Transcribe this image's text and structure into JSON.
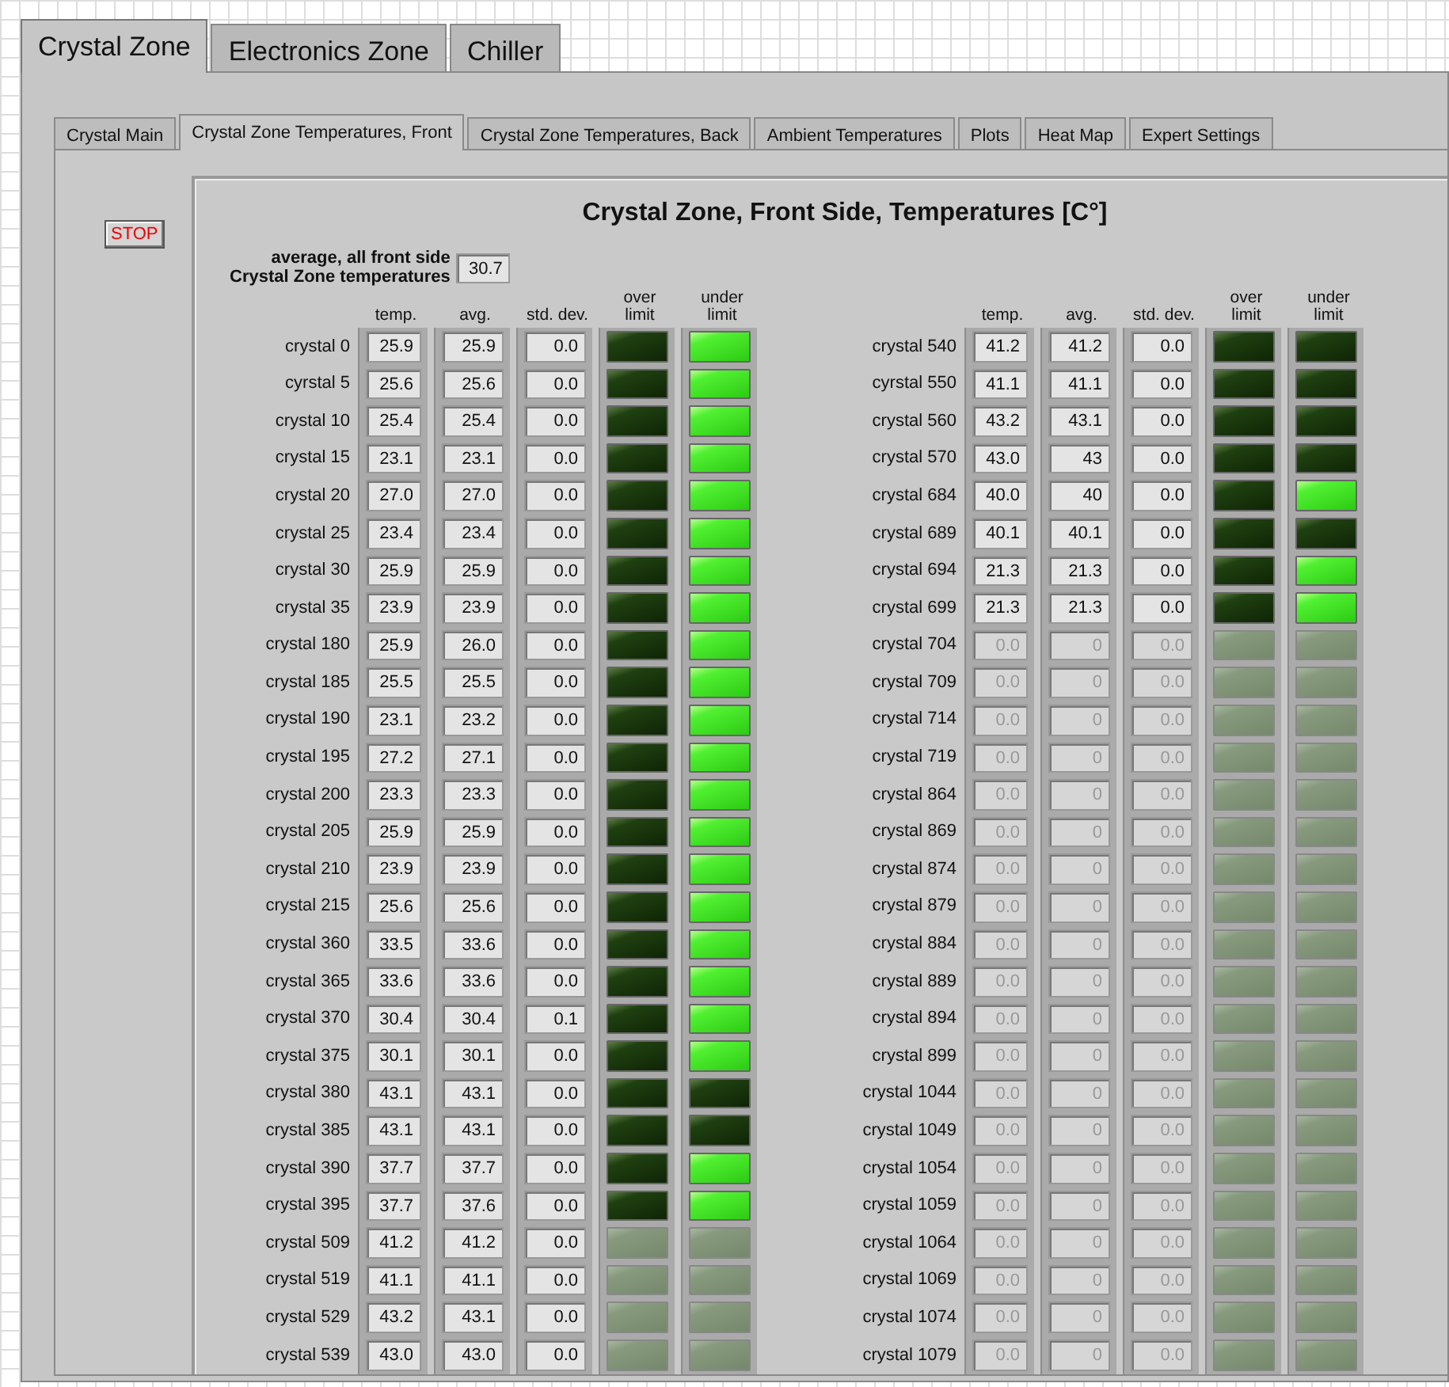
{
  "top_tabs": [
    {
      "label": "Crystal Zone",
      "selected": true
    },
    {
      "label": "Electronics Zone",
      "selected": false
    },
    {
      "label": "Chiller",
      "selected": false
    }
  ],
  "sub_tabs": [
    {
      "label": "Crystal Main",
      "selected": false
    },
    {
      "label": "Crystal Zone Temperatures, Front",
      "selected": true
    },
    {
      "label": "Crystal Zone Temperatures, Back",
      "selected": false
    },
    {
      "label": "Ambient Temperatures",
      "selected": false
    },
    {
      "label": "Plots",
      "selected": false
    },
    {
      "label": "Heat Map",
      "selected": false
    },
    {
      "label": "Expert Settings",
      "selected": false
    }
  ],
  "stop_button": "STOP",
  "title": "Crystal Zone, Front Side, Temperatures [C°]",
  "average": {
    "label_lines": [
      "average, all front side",
      "Crystal Zone temperatures"
    ],
    "value": "30.7"
  },
  "groups": [
    {
      "columns": [
        "temp.",
        "avg.",
        "std. dev.",
        "over limit",
        "under limit"
      ],
      "rows": [
        {
          "label": "crystal 0",
          "temp": "25.9",
          "avg": "25.9",
          "std": "0.0",
          "values_disabled": false,
          "leds_disabled": false,
          "over_limit": false,
          "under_limit": true
        },
        {
          "label": "cyrstal 5",
          "temp": "25.6",
          "avg": "25.6",
          "std": "0.0",
          "values_disabled": false,
          "leds_disabled": false,
          "over_limit": false,
          "under_limit": true
        },
        {
          "label": "crystal 10",
          "temp": "25.4",
          "avg": "25.4",
          "std": "0.0",
          "values_disabled": false,
          "leds_disabled": false,
          "over_limit": false,
          "under_limit": true
        },
        {
          "label": "crystal 15",
          "temp": "23.1",
          "avg": "23.1",
          "std": "0.0",
          "values_disabled": false,
          "leds_disabled": false,
          "over_limit": false,
          "under_limit": true
        },
        {
          "label": "crystal 20",
          "temp": "27.0",
          "avg": "27.0",
          "std": "0.0",
          "values_disabled": false,
          "leds_disabled": false,
          "over_limit": false,
          "under_limit": true
        },
        {
          "label": "crystal 25",
          "temp": "23.4",
          "avg": "23.4",
          "std": "0.0",
          "values_disabled": false,
          "leds_disabled": false,
          "over_limit": false,
          "under_limit": true
        },
        {
          "label": "crystal 30",
          "temp": "25.9",
          "avg": "25.9",
          "std": "0.0",
          "values_disabled": false,
          "leds_disabled": false,
          "over_limit": false,
          "under_limit": true
        },
        {
          "label": "crystal 35",
          "temp": "23.9",
          "avg": "23.9",
          "std": "0.0",
          "values_disabled": false,
          "leds_disabled": false,
          "over_limit": false,
          "under_limit": true
        },
        {
          "label": "crystal 180",
          "temp": "25.9",
          "avg": "26.0",
          "std": "0.0",
          "values_disabled": false,
          "leds_disabled": false,
          "over_limit": false,
          "under_limit": true
        },
        {
          "label": "crystal 185",
          "temp": "25.5",
          "avg": "25.5",
          "std": "0.0",
          "values_disabled": false,
          "leds_disabled": false,
          "over_limit": false,
          "under_limit": true
        },
        {
          "label": "crystal 190",
          "temp": "23.1",
          "avg": "23.2",
          "std": "0.0",
          "values_disabled": false,
          "leds_disabled": false,
          "over_limit": false,
          "under_limit": true
        },
        {
          "label": "crystal 195",
          "temp": "27.2",
          "avg": "27.1",
          "std": "0.0",
          "values_disabled": false,
          "leds_disabled": false,
          "over_limit": false,
          "under_limit": true
        },
        {
          "label": "crystal 200",
          "temp": "23.3",
          "avg": "23.3",
          "std": "0.0",
          "values_disabled": false,
          "leds_disabled": false,
          "over_limit": false,
          "under_limit": true
        },
        {
          "label": "crystal 205",
          "temp": "25.9",
          "avg": "25.9",
          "std": "0.0",
          "values_disabled": false,
          "leds_disabled": false,
          "over_limit": false,
          "under_limit": true
        },
        {
          "label": "crystal 210",
          "temp": "23.9",
          "avg": "23.9",
          "std": "0.0",
          "values_disabled": false,
          "leds_disabled": false,
          "over_limit": false,
          "under_limit": true
        },
        {
          "label": "crystal 215",
          "temp": "25.6",
          "avg": "25.6",
          "std": "0.0",
          "values_disabled": false,
          "leds_disabled": false,
          "over_limit": false,
          "under_limit": true
        },
        {
          "label": "crystal 360",
          "temp": "33.5",
          "avg": "33.6",
          "std": "0.0",
          "values_disabled": false,
          "leds_disabled": false,
          "over_limit": false,
          "under_limit": true
        },
        {
          "label": "crystal 365",
          "temp": "33.6",
          "avg": "33.6",
          "std": "0.0",
          "values_disabled": false,
          "leds_disabled": false,
          "over_limit": false,
          "under_limit": true
        },
        {
          "label": "crystal 370",
          "temp": "30.4",
          "avg": "30.4",
          "std": "0.1",
          "values_disabled": false,
          "leds_disabled": false,
          "over_limit": false,
          "under_limit": true
        },
        {
          "label": "crystal 375",
          "temp": "30.1",
          "avg": "30.1",
          "std": "0.0",
          "values_disabled": false,
          "leds_disabled": false,
          "over_limit": false,
          "under_limit": true
        },
        {
          "label": "crystal 380",
          "temp": "43.1",
          "avg": "43.1",
          "std": "0.0",
          "values_disabled": false,
          "leds_disabled": false,
          "over_limit": false,
          "under_limit": false
        },
        {
          "label": "crystal 385",
          "temp": "43.1",
          "avg": "43.1",
          "std": "0.0",
          "values_disabled": false,
          "leds_disabled": false,
          "over_limit": false,
          "under_limit": false
        },
        {
          "label": "crystal 390",
          "temp": "37.7",
          "avg": "37.7",
          "std": "0.0",
          "values_disabled": false,
          "leds_disabled": false,
          "over_limit": false,
          "under_limit": true
        },
        {
          "label": "crystal 395",
          "temp": "37.7",
          "avg": "37.6",
          "std": "0.0",
          "values_disabled": false,
          "leds_disabled": false,
          "over_limit": false,
          "under_limit": true
        },
        {
          "label": "crystal 509",
          "temp": "41.2",
          "avg": "41.2",
          "std": "0.0",
          "values_disabled": false,
          "leds_disabled": true
        },
        {
          "label": "crystal 519",
          "temp": "41.1",
          "avg": "41.1",
          "std": "0.0",
          "values_disabled": false,
          "leds_disabled": true
        },
        {
          "label": "crystal 529",
          "temp": "43.2",
          "avg": "43.1",
          "std": "0.0",
          "values_disabled": false,
          "leds_disabled": true
        },
        {
          "label": "crystal 539",
          "temp": "43.0",
          "avg": "43.0",
          "std": "0.0",
          "values_disabled": false,
          "leds_disabled": true
        }
      ]
    },
    {
      "columns": [
        "temp.",
        "avg.",
        "std. dev.",
        "over limit",
        "under limit"
      ],
      "rows": [
        {
          "label": "crystal 540",
          "temp": "41.2",
          "avg": "41.2",
          "std": "0.0",
          "values_disabled": false,
          "leds_disabled": false,
          "over_limit": false,
          "under_limit": false
        },
        {
          "label": "cyrstal 550",
          "temp": "41.1",
          "avg": "41.1",
          "std": "0.0",
          "values_disabled": false,
          "leds_disabled": false,
          "over_limit": false,
          "under_limit": false
        },
        {
          "label": "crystal 560",
          "temp": "43.2",
          "avg": "43.1",
          "std": "0.0",
          "values_disabled": false,
          "leds_disabled": false,
          "over_limit": false,
          "under_limit": false
        },
        {
          "label": "crystal 570",
          "temp": "43.0",
          "avg": "43",
          "std": "0.0",
          "values_disabled": false,
          "leds_disabled": false,
          "over_limit": false,
          "under_limit": false
        },
        {
          "label": "crystal 684",
          "temp": "40.0",
          "avg": "40",
          "std": "0.0",
          "values_disabled": false,
          "leds_disabled": false,
          "over_limit": false,
          "under_limit": true
        },
        {
          "label": "crystal 689",
          "temp": "40.1",
          "avg": "40.1",
          "std": "0.0",
          "values_disabled": false,
          "leds_disabled": false,
          "over_limit": false,
          "under_limit": false
        },
        {
          "label": "crystal 694",
          "temp": "21.3",
          "avg": "21.3",
          "std": "0.0",
          "values_disabled": false,
          "leds_disabled": false,
          "over_limit": false,
          "under_limit": true
        },
        {
          "label": "crystal 699",
          "temp": "21.3",
          "avg": "21.3",
          "std": "0.0",
          "values_disabled": false,
          "leds_disabled": false,
          "over_limit": false,
          "under_limit": true
        },
        {
          "label": "crystal 704",
          "temp": "0.0",
          "avg": "0",
          "std": "0.0",
          "values_disabled": true,
          "leds_disabled": true
        },
        {
          "label": "crystal 709",
          "temp": "0.0",
          "avg": "0",
          "std": "0.0",
          "values_disabled": true,
          "leds_disabled": true
        },
        {
          "label": "crystal 714",
          "temp": "0.0",
          "avg": "0",
          "std": "0.0",
          "values_disabled": true,
          "leds_disabled": true
        },
        {
          "label": "crystal 719",
          "temp": "0.0",
          "avg": "0",
          "std": "0.0",
          "values_disabled": true,
          "leds_disabled": true
        },
        {
          "label": "crystal 864",
          "temp": "0.0",
          "avg": "0",
          "std": "0.0",
          "values_disabled": true,
          "leds_disabled": true
        },
        {
          "label": "crystal 869",
          "temp": "0.0",
          "avg": "0",
          "std": "0.0",
          "values_disabled": true,
          "leds_disabled": true
        },
        {
          "label": "crystal 874",
          "temp": "0.0",
          "avg": "0",
          "std": "0.0",
          "values_disabled": true,
          "leds_disabled": true
        },
        {
          "label": "crystal 879",
          "temp": "0.0",
          "avg": "0",
          "std": "0.0",
          "values_disabled": true,
          "leds_disabled": true
        },
        {
          "label": "crystal 884",
          "temp": "0.0",
          "avg": "0",
          "std": "0.0",
          "values_disabled": true,
          "leds_disabled": true
        },
        {
          "label": "crystal 889",
          "temp": "0.0",
          "avg": "0",
          "std": "0.0",
          "values_disabled": true,
          "leds_disabled": true
        },
        {
          "label": "crystal 894",
          "temp": "0.0",
          "avg": "0",
          "std": "0.0",
          "values_disabled": true,
          "leds_disabled": true
        },
        {
          "label": "crystal 899",
          "temp": "0.0",
          "avg": "0",
          "std": "0.0",
          "values_disabled": true,
          "leds_disabled": true
        },
        {
          "label": "crystal 1044",
          "temp": "0.0",
          "avg": "0",
          "std": "0.0",
          "values_disabled": true,
          "leds_disabled": true
        },
        {
          "label": "crystal 1049",
          "temp": "0.0",
          "avg": "0",
          "std": "0.0",
          "values_disabled": true,
          "leds_disabled": true
        },
        {
          "label": "crystal 1054",
          "temp": "0.0",
          "avg": "0",
          "std": "0.0",
          "values_disabled": true,
          "leds_disabled": true
        },
        {
          "label": "crystal 1059",
          "temp": "0.0",
          "avg": "0",
          "std": "0.0",
          "values_disabled": true,
          "leds_disabled": true
        },
        {
          "label": "crystal 1064",
          "temp": "0.0",
          "avg": "0",
          "std": "0.0",
          "values_disabled": true,
          "leds_disabled": true
        },
        {
          "label": "crystal 1069",
          "temp": "0.0",
          "avg": "0",
          "std": "0.0",
          "values_disabled": true,
          "leds_disabled": true
        },
        {
          "label": "crystal 1074",
          "temp": "0.0",
          "avg": "0",
          "std": "0.0",
          "values_disabled": true,
          "leds_disabled": true
        },
        {
          "label": "crystal 1079",
          "temp": "0.0",
          "avg": "0",
          "std": "0.0",
          "values_disabled": true,
          "leds_disabled": true
        }
      ]
    }
  ]
}
